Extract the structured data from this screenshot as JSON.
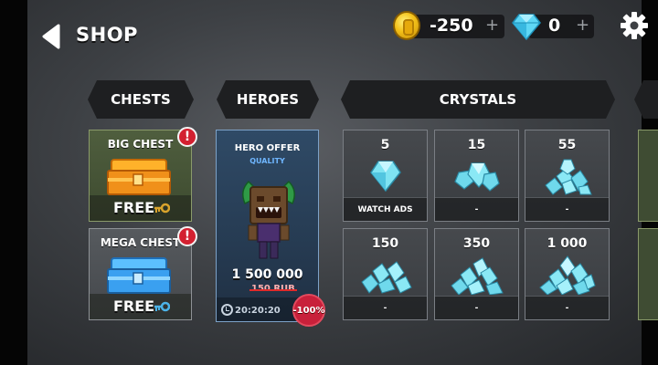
{
  "header": {
    "title": "SHOP",
    "coins": {
      "value": "-250",
      "plus": "+"
    },
    "gems": {
      "value": "0",
      "plus": "+"
    }
  },
  "tabs": [
    {
      "label": "CHESTS"
    },
    {
      "label": "HEROES"
    },
    {
      "label": "CRYSTALS"
    }
  ],
  "chests": [
    {
      "title": "BIG CHEST",
      "price": "FREE",
      "alert": "!",
      "color": "#f39a1b"
    },
    {
      "title": "MEGA CHEST",
      "price": "FREE",
      "alert": "!",
      "color": "#3ea2f0"
    }
  ],
  "hero_offer": {
    "title": "HERO OFFER",
    "quality": "QUALITY",
    "price": "1 500 000",
    "old_price": "150 RUB",
    "timer": "20:20:20",
    "discount": "-100%"
  },
  "crystals": [
    {
      "amount": "5",
      "label": "WATCH ADS"
    },
    {
      "amount": "15",
      "label": "-"
    },
    {
      "amount": "55",
      "label": "-"
    },
    {
      "amount": "150",
      "label": "-"
    },
    {
      "amount": "350",
      "label": "-"
    },
    {
      "amount": "1 000",
      "label": "-"
    }
  ],
  "colors": {
    "background": "#3d4044",
    "tab": "#1e1f21",
    "chest_green": "#4f5e3e",
    "hero_blue": "#2f4a66",
    "alert_red": "#d32030",
    "crystal": "#7fe3f2"
  }
}
